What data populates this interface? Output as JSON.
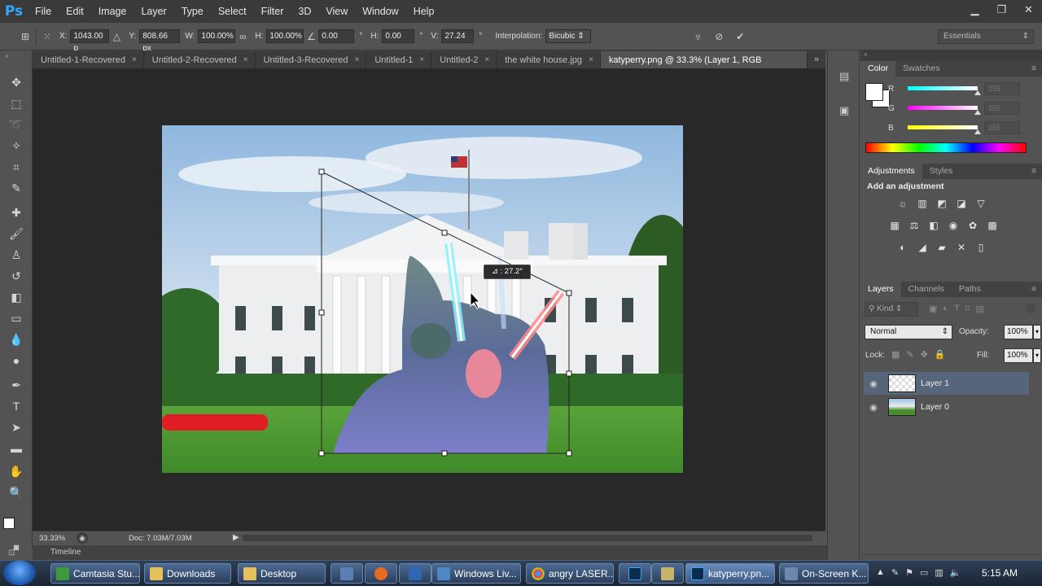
{
  "app": {
    "logo": "Ps",
    "menu": [
      "File",
      "Edit",
      "Image",
      "Layer",
      "Type",
      "Select",
      "Filter",
      "3D",
      "View",
      "Window",
      "Help"
    ],
    "window_controls": [
      "minimize-icon",
      "restore-icon",
      "close-icon"
    ]
  },
  "options": {
    "x_label": "X:",
    "x": "1043.00 p",
    "y_label": "Y:",
    "y": "808.66 px",
    "w_label": "W:",
    "w": "100.00%",
    "h_label": "H:",
    "h": "100.00%",
    "angle": "0.00",
    "h_skew_label": "H:",
    "h_skew": "0.00",
    "v_skew_label": "V:",
    "v_skew": "27.24",
    "degree": "°",
    "interp_label": "Interpolation:",
    "interp": "Bicubic",
    "workspace": "Essentials"
  },
  "tabs": [
    {
      "label": "Untitled-1-Recovered",
      "active": false
    },
    {
      "label": "Untitled-2-Recovered",
      "active": false
    },
    {
      "label": "Untitled-3-Recovered",
      "active": false
    },
    {
      "label": "Untitled-1",
      "active": false
    },
    {
      "label": "Untitled-2",
      "active": false
    },
    {
      "label": "the white house.jpg",
      "active": false
    },
    {
      "label": "katyperry.png @ 33.3% (Layer 1, RGB",
      "active": true
    }
  ],
  "tab_close": "×",
  "tab_overflow": "»",
  "tools": [
    "move-tool",
    "marquee-tool",
    "lasso-tool",
    "magic-wand-tool",
    "crop-tool",
    "eyedropper-tool",
    "healing-brush-tool",
    "brush-tool",
    "clone-stamp-tool",
    "history-brush-tool",
    "eraser-tool",
    "gradient-tool",
    "blur-tool",
    "dodge-tool",
    "pen-tool",
    "type-tool",
    "path-selection-tool",
    "rectangle-tool",
    "hand-tool",
    "zoom-tool"
  ],
  "canvas": {
    "angle_readout": "⊿ : 27.2°"
  },
  "status": {
    "zoom": "33.33%",
    "doc": "Doc: 7.03M/7.03M"
  },
  "timeline": {
    "label": "Timeline"
  },
  "color_panel": {
    "tabs": [
      "Color",
      "Swatches"
    ],
    "r_label": "R",
    "g_label": "G",
    "b_label": "B",
    "r": "255",
    "g": "255",
    "b": "255",
    "r_level": 1.0,
    "g_level": 1.0,
    "b_level": 1.0
  },
  "adjust_panel": {
    "tabs": [
      "Adjustments",
      "Styles"
    ],
    "heading": "Add an adjustment"
  },
  "layers_panel": {
    "tabs": [
      "Layers",
      "Channels",
      "Paths"
    ],
    "filter": "Kind",
    "blend": "Normal",
    "opacity_label": "Opacity:",
    "opacity": "100%",
    "lock_label": "Lock:",
    "fill_label": "Fill:",
    "fill": "100%",
    "layers": [
      {
        "name": "Layer 1",
        "selected": true
      },
      {
        "name": "Layer 0",
        "selected": false
      }
    ]
  },
  "taskbar": {
    "items": [
      "Camtasia Stu...",
      "Downloads",
      "Desktop",
      "Windows Liv...",
      "angry LASER...",
      "katyperry.pn...",
      "On-Screen K..."
    ],
    "clock": "5:15 AM"
  },
  "colors": {
    "accent": "#31a8ff",
    "selection": "#56657a"
  }
}
